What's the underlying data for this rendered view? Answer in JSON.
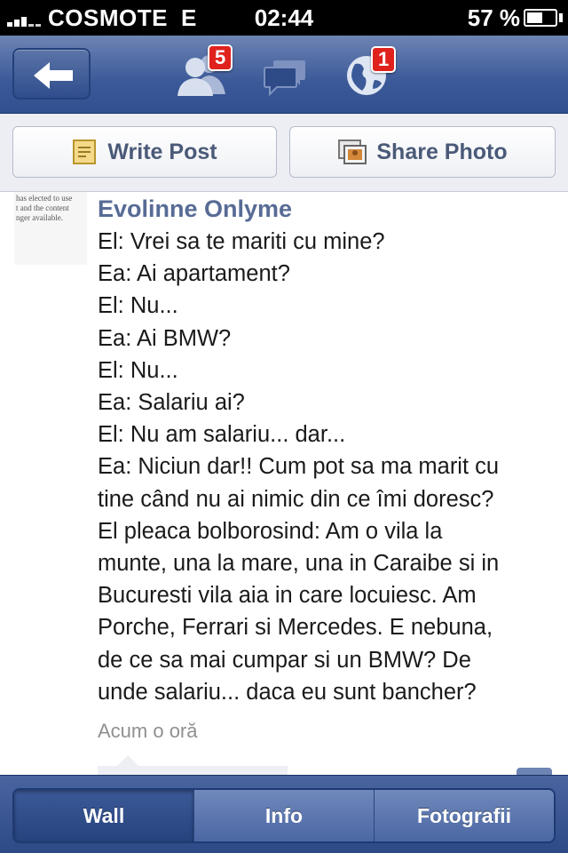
{
  "status_bar": {
    "carrier": "COSMOTE",
    "network": "E",
    "time": "02:44",
    "battery_pct": "57 %",
    "battery_level": 0.57,
    "signal_bars": 3
  },
  "nav": {
    "back_icon": "back-arrow-icon",
    "friend_requests_badge": "5",
    "notifications_badge": "1"
  },
  "actions": {
    "write_post_label": "Write Post",
    "share_photo_label": "Share Photo"
  },
  "post": {
    "thumb_lines": [
      "has elected to use",
      "t and the content",
      "nger available."
    ],
    "author": "Evolinne Onlyme",
    "lines": [
      "El: Vrei sa te mariti cu mine?",
      "Ea: Ai apartament?",
      "El: Nu...",
      "Ea: Ai BMW?",
      "El: Nu...",
      "Ea: Salariu ai?",
      "El: Nu am salariu... dar...",
      "Ea: Niciun dar!! Cum pot sa ma marit cu",
      "tine când nu ai nimic din ce îmi doresc?",
      "El pleaca bolborosind: Am o vila la",
      "munte, una la mare, una in Caraibe si in",
      "Bucuresti vila aia in care locuiesc. Am",
      "Porche, Ferrari si Mercedes. E nebuna,",
      "de ce sa mai cumpar si un BMW? De",
      "unde salariu... daca eu sunt bancher?"
    ],
    "timestamp": "Acum o oră"
  },
  "tabs": [
    {
      "label": "Wall",
      "active": true
    },
    {
      "label": "Info",
      "active": false
    },
    {
      "label": "Fotografii",
      "active": false
    }
  ],
  "colors": {
    "fb_blue": "#3b5998",
    "author_blue": "#576b95",
    "badge_red": "#e0221d"
  }
}
